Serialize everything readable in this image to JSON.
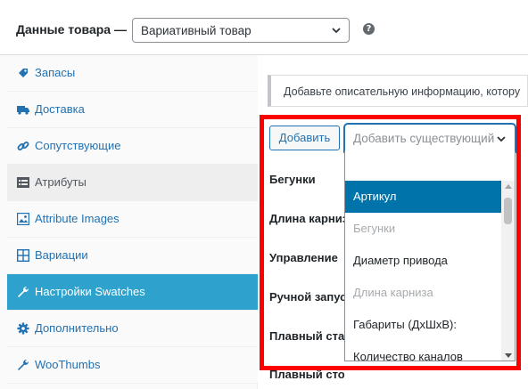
{
  "header": {
    "title": "Данные товара —",
    "product_type": "Вариативный товар",
    "help_label": "?"
  },
  "sidebar": {
    "items": [
      {
        "label": "Запасы",
        "icon": "inventory-icon"
      },
      {
        "label": "Доставка",
        "icon": "truck-icon"
      },
      {
        "label": "Сопутствующие",
        "icon": "link-icon"
      },
      {
        "label": "Атрибуты",
        "icon": "attributes-icon"
      },
      {
        "label": "Attribute Images",
        "icon": "image-icon"
      },
      {
        "label": "Вариации",
        "icon": "grid-icon"
      },
      {
        "label": "Настройки Swatches",
        "icon": "wrench-icon"
      },
      {
        "label": "Дополнительно",
        "icon": "gear-icon"
      },
      {
        "label": "WooThumbs",
        "icon": "wrench-icon"
      }
    ],
    "active_index": 6
  },
  "main": {
    "notice": "Добавьте описательную информацию, котору",
    "add_button": "Добавить",
    "attribute_select_placeholder": "Добавить существующий",
    "attributes": [
      "Бегунки",
      "Длина карниза",
      "Управление",
      "Ручной запуск",
      "Плавный старт",
      "Плавный стоп"
    ],
    "dropdown_options": [
      {
        "label": "Артикул",
        "state": "highlighted"
      },
      {
        "label": "Бегунки",
        "state": "disabled"
      },
      {
        "label": "Диаметр привода",
        "state": "normal"
      },
      {
        "label": "Длина карниза",
        "state": "disabled"
      },
      {
        "label": "Габариты (ДхШхВ):",
        "state": "normal"
      },
      {
        "label": "Количество каналов",
        "state": "normal"
      }
    ]
  },
  "colors": {
    "accent": "#2271b1",
    "active_tab": "#2ea2cc",
    "highlight_option": "#0073aa",
    "annotation_border": "#ff0000"
  }
}
